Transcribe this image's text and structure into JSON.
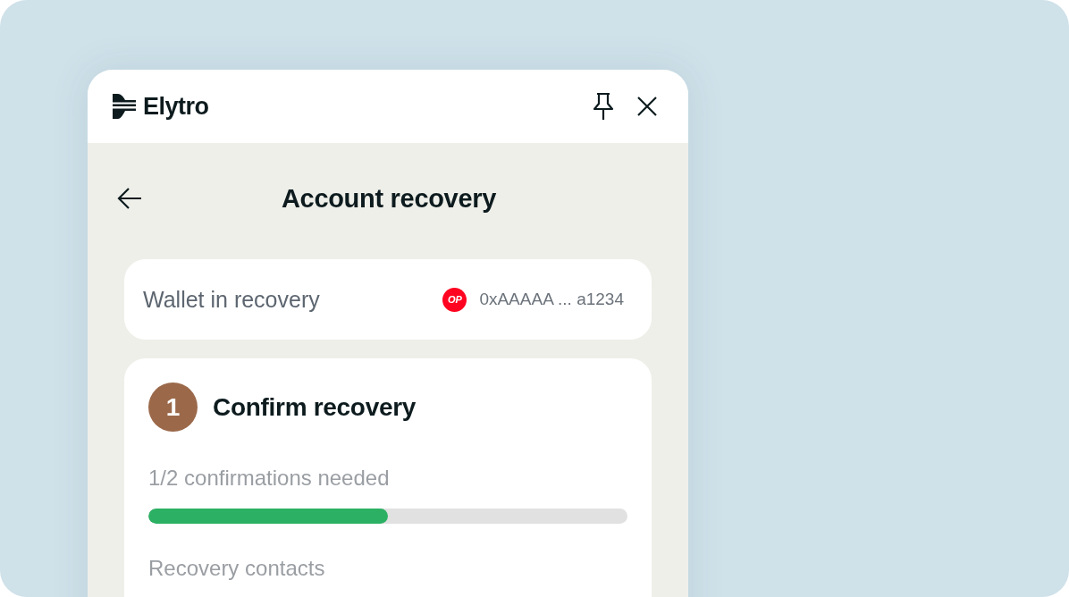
{
  "header": {
    "brand": "Elytro"
  },
  "page": {
    "title": "Account recovery"
  },
  "wallet": {
    "label": "Wallet in recovery",
    "network_badge": "OP",
    "address": "0xAAAAA ... a1234"
  },
  "step": {
    "number": "1",
    "title": "Confirm recovery",
    "progress_text": "1/2 confirmations needed",
    "level": 0.5,
    "section_label": "Recovery contacts"
  }
}
